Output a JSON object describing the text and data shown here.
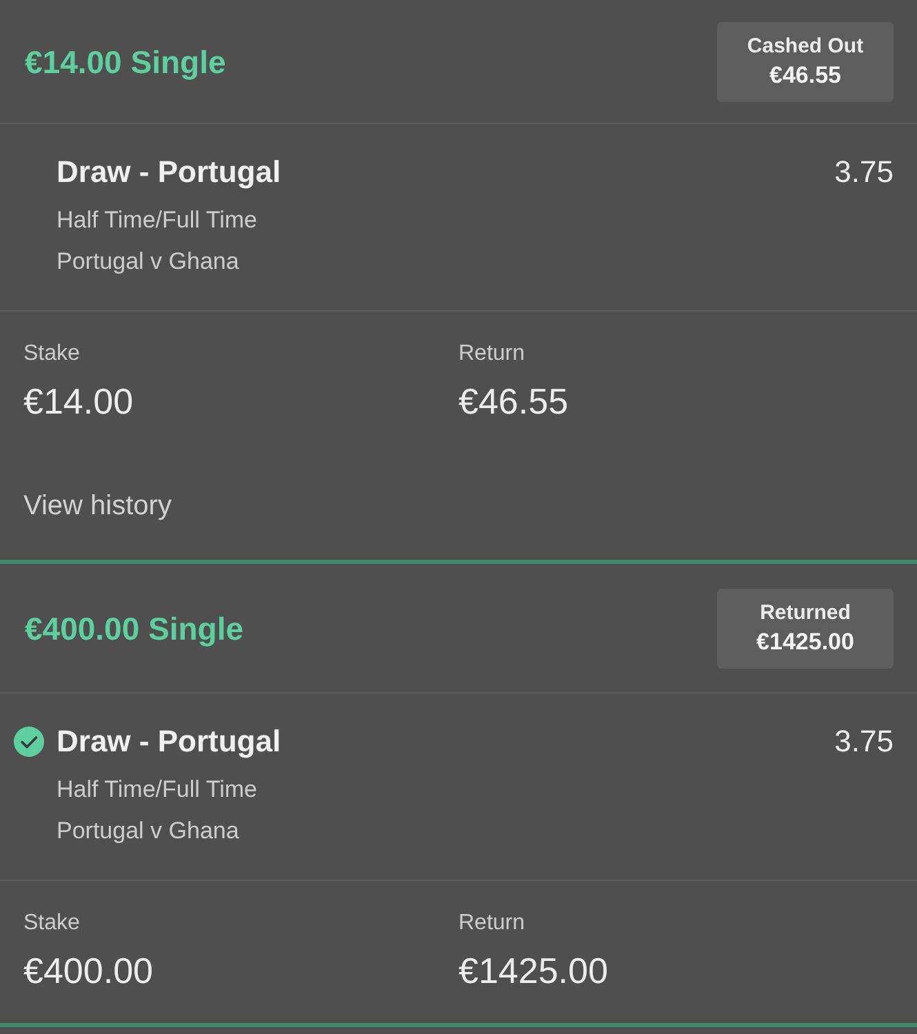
{
  "bets": [
    {
      "title": "€14.00 Single",
      "status": {
        "label": "Cashed Out",
        "amount": "€46.55"
      },
      "selection": {
        "name": "Draw - Portugal",
        "won": false,
        "market": "Half Time/Full Time",
        "event": "Portugal v Ghana",
        "odds": "3.75"
      },
      "stake": {
        "label": "Stake",
        "value": "€14.00"
      },
      "return": {
        "label": "Return",
        "value": "€46.55"
      },
      "link": "View history"
    },
    {
      "title": "€400.00 Single",
      "status": {
        "label": "Returned",
        "amount": "€1425.00"
      },
      "selection": {
        "name": "Draw - Portugal",
        "won": true,
        "market": "Half Time/Full Time",
        "event": "Portugal v Ghana",
        "odds": "3.75"
      },
      "stake": {
        "label": "Stake",
        "value": "€400.00"
      },
      "return": {
        "label": "Return",
        "value": "€1425.00"
      }
    }
  ]
}
